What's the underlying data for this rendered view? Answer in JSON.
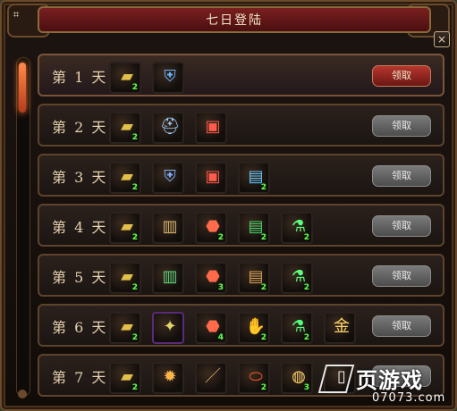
{
  "window": {
    "title": "七日登陆",
    "close_symbol": "×"
  },
  "rows": [
    {
      "day_label": "第 1 天",
      "claim_label": "领取",
      "claim_color": "#b6372e",
      "items": [
        {
          "icon": "gold-ingot-icon",
          "glyph": "▰",
          "qty": "2"
        },
        {
          "icon": "blue-armor-icon",
          "glyph": "⛨",
          "qty": ""
        }
      ]
    },
    {
      "day_label": "第 2 天",
      "claim_label": "领取",
      "claim_color": "#6f6f6f",
      "items": [
        {
          "icon": "gold-ingot-icon",
          "glyph": "▰",
          "qty": "2"
        },
        {
          "icon": "winged-helmet-icon",
          "glyph": "⛑",
          "qty": ""
        },
        {
          "icon": "red-book-icon",
          "glyph": "▣",
          "qty": ""
        }
      ]
    },
    {
      "day_label": "第 3 天",
      "claim_label": "领取",
      "claim_color": "#6f6f6f",
      "items": [
        {
          "icon": "gold-ingot-icon",
          "glyph": "▰",
          "qty": "2"
        },
        {
          "icon": "shoulder-armor-icon",
          "glyph": "⛨",
          "qty": ""
        },
        {
          "icon": "red-book-icon",
          "glyph": "▣",
          "qty": ""
        },
        {
          "icon": "blue-scroll-icon",
          "glyph": "▤",
          "qty": "2"
        }
      ]
    },
    {
      "day_label": "第 4 天",
      "claim_label": "领取",
      "claim_color": "#6f6f6f",
      "items": [
        {
          "icon": "gold-ingot-icon",
          "glyph": "▰",
          "qty": "2"
        },
        {
          "icon": "chest-armor-icon",
          "glyph": "▥",
          "qty": ""
        },
        {
          "icon": "red-gem-icon",
          "glyph": "⬣",
          "qty": "2"
        },
        {
          "icon": "green-scroll-icon",
          "glyph": "▤",
          "qty": "2"
        },
        {
          "icon": "green-potion-icon",
          "glyph": "⚗",
          "qty": "2"
        }
      ]
    },
    {
      "day_label": "第 5 天",
      "claim_label": "领取",
      "claim_color": "#6f6f6f",
      "items": [
        {
          "icon": "gold-ingot-icon",
          "glyph": "▰",
          "qty": "2"
        },
        {
          "icon": "green-armor-icon",
          "glyph": "▥",
          "qty": ""
        },
        {
          "icon": "red-gem-icon",
          "glyph": "⬣",
          "qty": "3"
        },
        {
          "icon": "brown-scroll-icon",
          "glyph": "▤",
          "qty": "2"
        },
        {
          "icon": "green-potion-icon",
          "glyph": "⚗",
          "qty": "2"
        }
      ]
    },
    {
      "day_label": "第 6 天",
      "claim_label": "领取",
      "claim_color": "#6f6f6f",
      "items": [
        {
          "icon": "gold-ingot-icon",
          "glyph": "▰",
          "qty": "2"
        },
        {
          "icon": "sparkle-armor-icon",
          "glyph": "✦",
          "qty": ""
        },
        {
          "icon": "red-gem-icon",
          "glyph": "⬣",
          "qty": "4"
        },
        {
          "icon": "gauntlet-icon",
          "glyph": "✋",
          "qty": "2"
        },
        {
          "icon": "green-flask-icon",
          "glyph": "⚗",
          "qty": "2"
        },
        {
          "icon": "gold-seal-icon",
          "glyph": "金",
          "qty": ""
        }
      ]
    },
    {
      "day_label": "第 7 天",
      "claim_label": "",
      "claim_color": "#6f6f6f",
      "items": [
        {
          "icon": "gold-ingot-icon",
          "glyph": "▰",
          "qty": "2"
        },
        {
          "icon": "sunburst-icon",
          "glyph": "✹",
          "qty": ""
        },
        {
          "icon": "staff-icon",
          "glyph": "／",
          "qty": ""
        },
        {
          "icon": "red-egg-icon",
          "glyph": "⬭",
          "qty": "2"
        },
        {
          "icon": "orb-dish-icon",
          "glyph": "◍",
          "qty": "3"
        },
        {
          "icon": "document-icon",
          "glyph": "▯",
          "qty": ""
        }
      ]
    }
  ],
  "watermark": {
    "brand": "页游戏",
    "site": "07073.com"
  },
  "colors": {
    "frame_border": "#6b4a2a",
    "title_bar": "#7a1f1f",
    "qty_text": "#64ff4a"
  }
}
